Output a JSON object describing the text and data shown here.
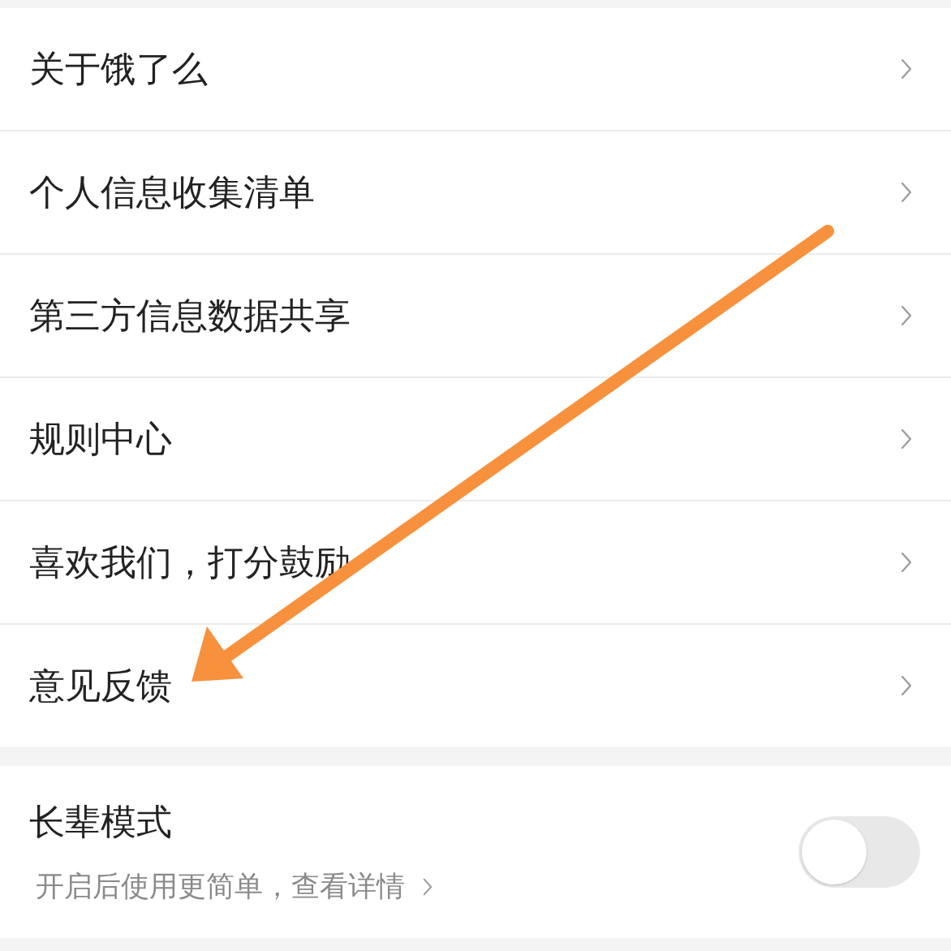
{
  "menu": [
    {
      "label": "关于饿了么"
    },
    {
      "label": "个人信息收集清单"
    },
    {
      "label": "第三方信息数据共享"
    },
    {
      "label": "规则中心"
    },
    {
      "label": "喜欢我们，打分鼓励"
    },
    {
      "label": "意见反馈"
    }
  ],
  "elder_mode": {
    "title": "长辈模式",
    "subtitle": "开启后使用更简单，查看详情",
    "on": false
  }
}
